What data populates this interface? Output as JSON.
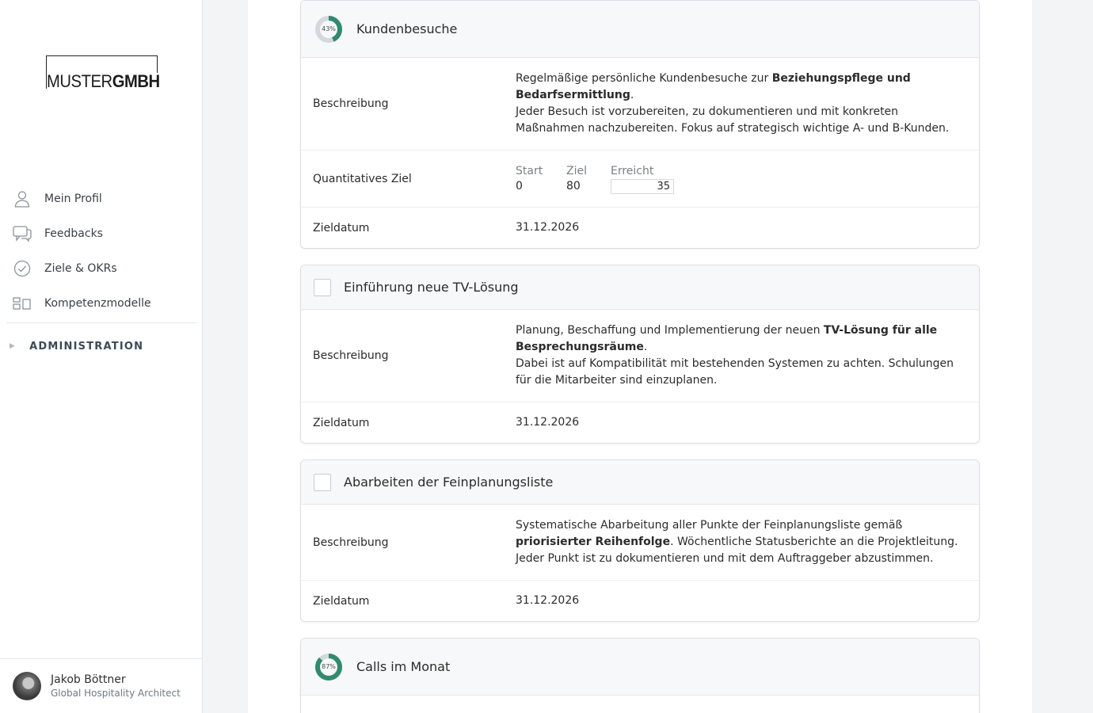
{
  "brand": {
    "logo_thin": "MUSTER",
    "logo_bold": "GMBH"
  },
  "sidebar": {
    "items": [
      {
        "label": "Mein Profil",
        "icon": "user-icon"
      },
      {
        "label": "Feedbacks",
        "icon": "chat-icon"
      },
      {
        "label": "Ziele & OKRs",
        "icon": "check-circle-icon"
      },
      {
        "label": "Kompetenzmodelle",
        "icon": "model-icon"
      }
    ],
    "admin_label": "ADMINISTRATION"
  },
  "user": {
    "name": "Jakob Böttner",
    "role": "Global Hospitality Architect"
  },
  "colors": {
    "accent": "#2e8b6e",
    "donut_track": "#d5d8db"
  },
  "goals": [
    {
      "title": "Kundenbesuche",
      "progress_label": "43%",
      "progress": 0.4375,
      "description_label": "Beschreibung",
      "description": {
        "p1_pre": "Regelmäßige persönliche Kundenbesuche zur ",
        "p1_bold": "Beziehungspflege und Bedarfsermittlung",
        "p1_post": ".",
        "p2": "Jeder Besuch ist vorzubereiten, zu dokumentieren und mit konkreten Maßnahmen nachzubereiten. Fokus auf strategisch wichtige A- und B-Kunden."
      },
      "quant_label": "Quantitatives Ziel",
      "start_label": "Start",
      "start": "0",
      "target_label": "Ziel",
      "target": "80",
      "achieved_label": "Erreicht",
      "achieved": "35",
      "date_label": "Zieldatum",
      "date": "31.12.2026"
    },
    {
      "title": "Einführung neue TV-Lösung",
      "description_label": "Beschreibung",
      "description": {
        "p1_pre": "Planung, Beschaffung und Implementierung der neuen ",
        "p1_bold": "TV-Lösung für alle Besprechungsräume",
        "p1_post": ".",
        "p2": "Dabei ist auf Kompatibilität mit bestehenden Systemen zu achten. Schulungen für die Mitarbeiter sind einzuplanen."
      },
      "date_label": "Zieldatum",
      "date": "31.12.2026"
    },
    {
      "title": "Abarbeiten der Feinplanungsliste",
      "description_label": "Beschreibung",
      "description": {
        "p1_pre": "Systematische Abarbeitung aller Punkte der Feinplanungsliste gemäß ",
        "p1_bold": "priorisierter Reihenfolge",
        "p1_post": ". Wöchentliche Statusberichte an die Projektleitung.",
        "p2": "Jeder Punkt ist zu dokumentieren und mit dem Auftraggeber abzustimmen."
      },
      "date_label": "Zieldatum",
      "date": "31.12.2026"
    },
    {
      "title": "Calls im Monat",
      "progress_label": "87%",
      "progress": 0.875
    }
  ]
}
